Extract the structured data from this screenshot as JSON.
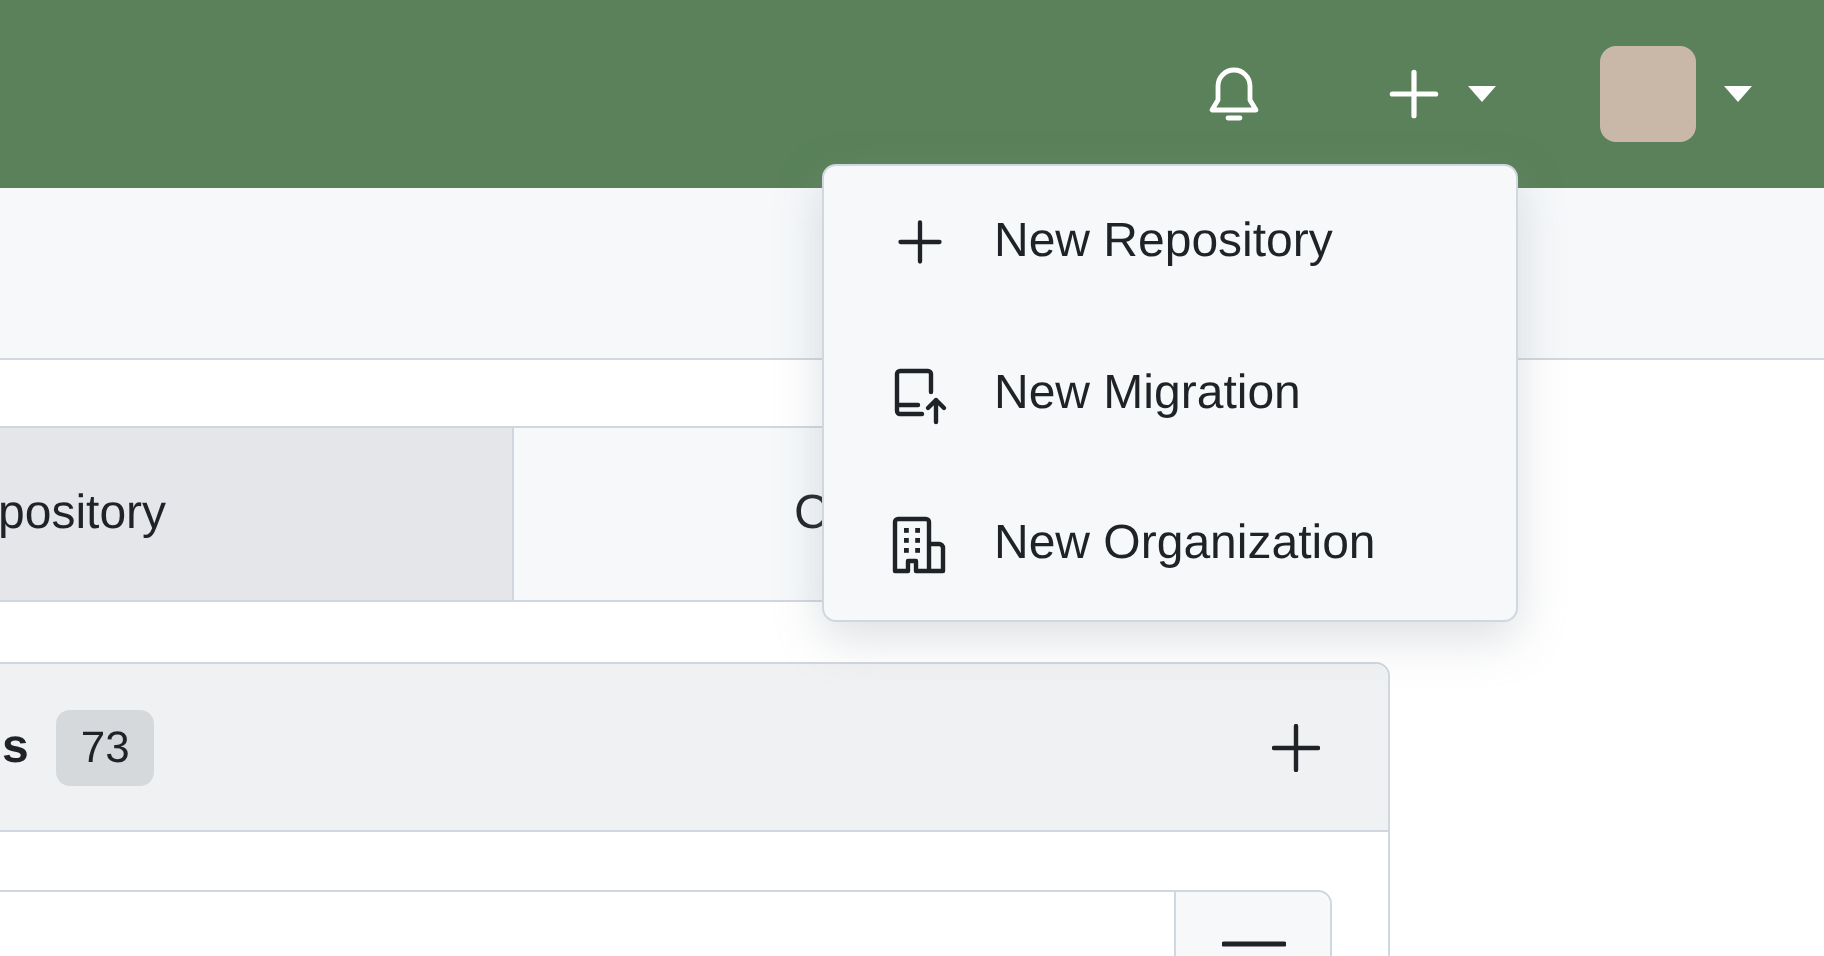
{
  "header": {
    "create_menu_open": true
  },
  "create_menu": {
    "items": [
      {
        "kind": "plus",
        "label": "New Repository"
      },
      {
        "kind": "migration",
        "label": "New Migration"
      },
      {
        "kind": "organization",
        "label": "New Organization"
      }
    ]
  },
  "tabs": [
    {
      "label": "pository",
      "selected": true
    },
    {
      "label": "C",
      "selected": false
    }
  ],
  "panel": {
    "title": "s",
    "count": "73"
  }
}
